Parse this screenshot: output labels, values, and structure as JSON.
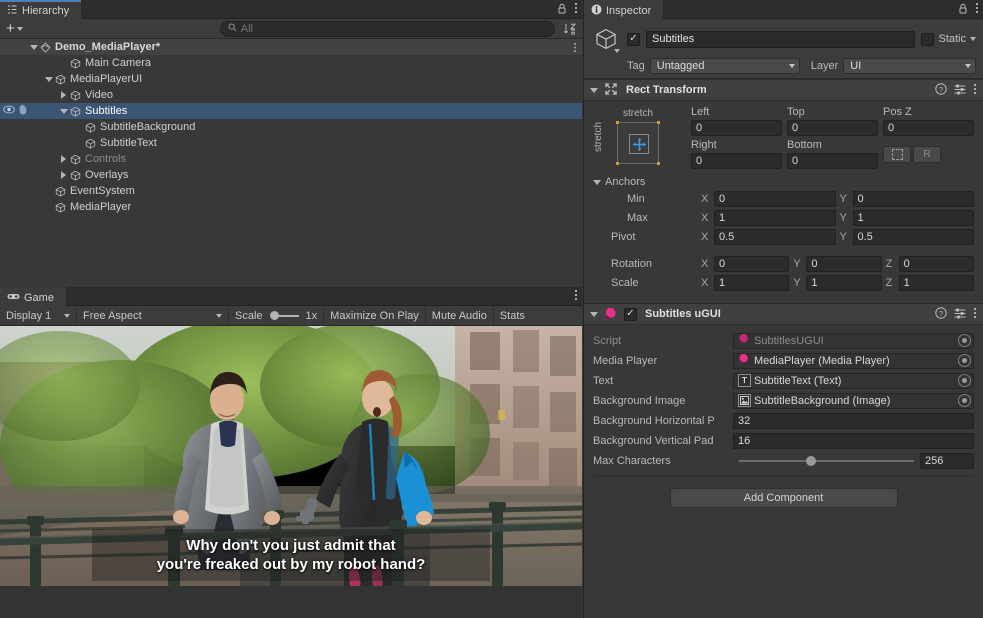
{
  "hierarchy": {
    "tab_label": "Hierarchy",
    "tab_icon": "hierarchy-icon",
    "add_button_label": "+",
    "search_placeholder": "All",
    "search_value": "",
    "sort_icon": "sort-alphabetical-icon",
    "items": [
      {
        "label": "Demo_MediaPlayer*",
        "depth": 0,
        "icon": "scene-icon",
        "expanded": true,
        "arrow": "down",
        "selected": false,
        "dim": false,
        "root": true
      },
      {
        "label": "Main Camera",
        "depth": 2,
        "icon": "gameobject-icon",
        "expanded": false,
        "arrow": "none",
        "selected": false,
        "dim": false,
        "root": false
      },
      {
        "label": "MediaPlayerUI",
        "depth": 1,
        "icon": "gameobject-icon",
        "expanded": true,
        "arrow": "down",
        "selected": false,
        "dim": false,
        "root": false
      },
      {
        "label": "Video",
        "depth": 2,
        "icon": "gameobject-icon",
        "expanded": false,
        "arrow": "right",
        "selected": false,
        "dim": false,
        "root": false
      },
      {
        "label": "Subtitles",
        "depth": 2,
        "icon": "gameobject-icon",
        "expanded": true,
        "arrow": "down",
        "selected": true,
        "dim": false,
        "root": false
      },
      {
        "label": "SubtitleBackground",
        "depth": 3,
        "icon": "gameobject-icon",
        "expanded": false,
        "arrow": "none",
        "selected": false,
        "dim": false,
        "root": false
      },
      {
        "label": "SubtitleText",
        "depth": 3,
        "icon": "gameobject-icon",
        "expanded": false,
        "arrow": "none",
        "selected": false,
        "dim": false,
        "root": false
      },
      {
        "label": "Controls",
        "depth": 2,
        "icon": "gameobject-icon",
        "expanded": false,
        "arrow": "right",
        "selected": false,
        "dim": true,
        "root": false
      },
      {
        "label": "Overlays",
        "depth": 2,
        "icon": "gameobject-icon",
        "expanded": false,
        "arrow": "right",
        "selected": false,
        "dim": false,
        "root": false
      },
      {
        "label": "EventSystem",
        "depth": 1,
        "icon": "gameobject-icon",
        "expanded": false,
        "arrow": "none",
        "selected": false,
        "dim": false,
        "root": false
      },
      {
        "label": "MediaPlayer",
        "depth": 1,
        "icon": "gameobject-icon",
        "expanded": false,
        "arrow": "none",
        "selected": false,
        "dim": false,
        "root": false
      }
    ],
    "visibility_toggle_icon": "eye-icon",
    "pick_toggle_icon": "pointer-hand-icon"
  },
  "game": {
    "tab_label": "Game",
    "tab_icon": "gamepad-icon",
    "display_label": "Display 1",
    "aspect_label": "Free Aspect",
    "scale_label": "Scale",
    "scale_value": "1x",
    "maximize_label": "Maximize On Play",
    "mute_label": "Mute Audio",
    "stats_label": "Stats",
    "subtitle_line1": "Why don't you just admit that",
    "subtitle_line2": "you're freaked out by my robot hand?"
  },
  "inspector": {
    "tab_label": "Inspector",
    "tab_icon": "info-icon",
    "lock_icon": "lock-icon",
    "menu_icon": "kebab-menu-icon",
    "object_enabled": true,
    "object_name": "Subtitles",
    "static_label": "Static",
    "static_checked": false,
    "tag_label": "Tag",
    "tag_value": "Untagged",
    "layer_label": "Layer",
    "layer_value": "UI",
    "rect_transform": {
      "title": "Rect Transform",
      "anchor_preset_top": "stretch",
      "anchor_preset_left": "stretch",
      "left_label": "Left",
      "left_value": "0",
      "top_label": "Top",
      "top_value": "0",
      "posz_label": "Pos Z",
      "posz_value": "0",
      "right_label": "Right",
      "right_value": "0",
      "bottom_label": "Bottom",
      "bottom_value": "0",
      "blueprint_icon": "blueprint-mode-icon",
      "raw_label": "R",
      "anchors_label": "Anchors",
      "min_label": "Min",
      "min_x": "0",
      "min_y": "0",
      "max_label": "Max",
      "max_x": "1",
      "max_y": "1",
      "pivot_label": "Pivot",
      "pivot_x": "0.5",
      "pivot_y": "0.5",
      "rotation_label": "Rotation",
      "rot_x": "0",
      "rot_y": "0",
      "rot_z": "0",
      "scale_label": "Scale",
      "scl_x": "1",
      "scl_y": "1",
      "scl_z": "1",
      "axis_x": "X",
      "axis_y": "Y",
      "axis_z": "Z"
    },
    "subtitles_ugui": {
      "title": "Subtitles uGUI",
      "enabled": true,
      "icon": "script-icon",
      "script_label": "Script",
      "script_value": "SubtitlesUGUI",
      "media_player_label": "Media Player",
      "media_player_value": "MediaPlayer (Media Player)",
      "text_label": "Text",
      "text_value": "SubtitleText (Text)",
      "background_image_label": "Background Image",
      "background_image_value": "SubtitleBackground (Image)",
      "bg_horizontal_label": "Background Horizontal P",
      "bg_horizontal_value": "32",
      "bg_vertical_label": "Background Vertical Pad",
      "bg_vertical_value": "16",
      "max_characters_label": "Max Characters",
      "max_characters_value": "256"
    },
    "add_component_label": "Add Component"
  },
  "colors": {
    "panel_bg": "#383838",
    "header_bg": "#3c3c3c",
    "tabbar_bg": "#2d2d2d",
    "selection_blue": "#3b5674",
    "field_bg": "#2b2b2b",
    "accent_tab": "#4a80c0",
    "script_pink": "#e8308a"
  }
}
